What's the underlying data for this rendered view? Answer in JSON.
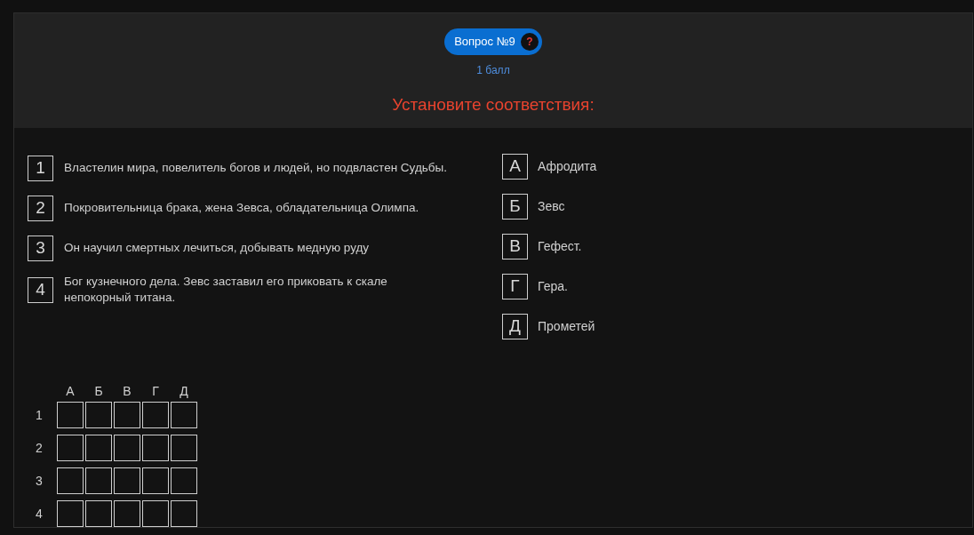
{
  "question": {
    "badge": "Вопрос №9",
    "help": "?",
    "points": "1 балл",
    "instruction": "Установите соответствия:"
  },
  "left_items": [
    {
      "label": "1",
      "text": "Властелин мира, повелитель богов и людей, но подвластен Судьбы."
    },
    {
      "label": "2",
      "text": "Покровительница брака, жена Зевса, обладательница Олимпа."
    },
    {
      "label": "3",
      "text": "Он научил смертных лечиться, добывать медную руду"
    },
    {
      "label": "4",
      "text": "Бог кузнечного дела. Зевс заставил его приковать к скале непокорный титана."
    }
  ],
  "right_items": [
    {
      "label": "А",
      "text": "Афродита"
    },
    {
      "label": "Б",
      "text": "Зевс"
    },
    {
      "label": "В",
      "text": "Гефест."
    },
    {
      "label": "Г",
      "text": "Гера."
    },
    {
      "label": "Д",
      "text": "Прометей"
    }
  ],
  "answer_grid": {
    "columns": [
      "А",
      "Б",
      "В",
      "Г",
      "Д"
    ],
    "rows": [
      "1",
      "2",
      "3",
      "4"
    ]
  }
}
